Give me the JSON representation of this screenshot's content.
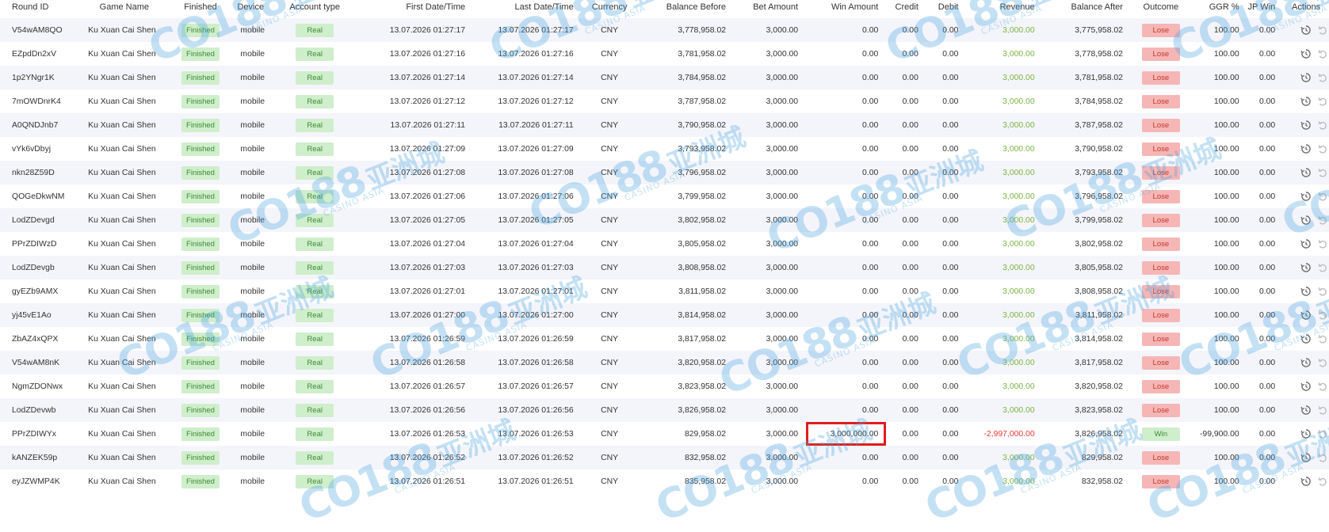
{
  "columns": [
    "Round ID",
    "Game Name",
    "Finished",
    "Device",
    "Account type",
    "First Date/Time",
    "Last Date/Time",
    "Currency",
    "Balance Before",
    "Bet Amount",
    "Win Amount",
    "Credit",
    "Debit",
    "Revenue",
    "Balance After",
    "Outcome",
    "GGR %",
    "JP Win",
    "Actions"
  ],
  "watermark": {
    "logo": "CO188",
    "cn": "亚洲城",
    "sub": "CASINO ASIA"
  },
  "colors": {
    "accent_red": "#e11d1d",
    "positive": "#7cb342",
    "negative": "#e53935",
    "pill_green": "#cfeecb",
    "pill_red": "#f6b6b6"
  },
  "icons": {
    "history": "history-icon",
    "undo": "undo-icon"
  },
  "rows": [
    {
      "round_id": "V54wAM8QO",
      "game": "Ku Xuan Cai Shen",
      "finished": "Finished",
      "device": "mobile",
      "account": "Real",
      "first": "13.07.2026 01:27:17",
      "last": "13.07.2026 01:27:17",
      "currency": "CNY",
      "bal_before": "3,778,958.02",
      "bet": "3,000.00",
      "win": "0.00",
      "credit": "0.00",
      "debit": "0.00",
      "revenue": "3,000.00",
      "bal_after": "3,775,958.02",
      "outcome": "Lose",
      "ggr": "100.00",
      "jp": "0.00"
    },
    {
      "round_id": "EZpdDn2xV",
      "game": "Ku Xuan Cai Shen",
      "finished": "Finished",
      "device": "mobile",
      "account": "Real",
      "first": "13.07.2026 01:27:16",
      "last": "13.07.2026 01:27:16",
      "currency": "CNY",
      "bal_before": "3,781,958.02",
      "bet": "3,000.00",
      "win": "0.00",
      "credit": "0.00",
      "debit": "0.00",
      "revenue": "3,000.00",
      "bal_after": "3,778,958.02",
      "outcome": "Lose",
      "ggr": "100.00",
      "jp": "0.00"
    },
    {
      "round_id": "1p2YNgr1K",
      "game": "Ku Xuan Cai Shen",
      "finished": "Finished",
      "device": "mobile",
      "account": "Real",
      "first": "13.07.2026 01:27:14",
      "last": "13.07.2026 01:27:14",
      "currency": "CNY",
      "bal_before": "3,784,958.02",
      "bet": "3,000.00",
      "win": "0.00",
      "credit": "0.00",
      "debit": "0.00",
      "revenue": "3,000.00",
      "bal_after": "3,781,958.02",
      "outcome": "Lose",
      "ggr": "100.00",
      "jp": "0.00"
    },
    {
      "round_id": "7mOWDnrK4",
      "game": "Ku Xuan Cai Shen",
      "finished": "Finished",
      "device": "mobile",
      "account": "Real",
      "first": "13.07.2026 01:27:12",
      "last": "13.07.2026 01:27:12",
      "currency": "CNY",
      "bal_before": "3,787,958.02",
      "bet": "3,000.00",
      "win": "0.00",
      "credit": "0.00",
      "debit": "0.00",
      "revenue": "3,000.00",
      "bal_after": "3,784,958.02",
      "outcome": "Lose",
      "ggr": "100.00",
      "jp": "0.00"
    },
    {
      "round_id": "A0QNDJnb7",
      "game": "Ku Xuan Cai Shen",
      "finished": "Finished",
      "device": "mobile",
      "account": "Real",
      "first": "13.07.2026 01:27:11",
      "last": "13.07.2026 01:27:11",
      "currency": "CNY",
      "bal_before": "3,790,958.02",
      "bet": "3,000.00",
      "win": "0.00",
      "credit": "0.00",
      "debit": "0.00",
      "revenue": "3,000.00",
      "bal_after": "3,787,958.02",
      "outcome": "Lose",
      "ggr": "100.00",
      "jp": "0.00"
    },
    {
      "round_id": "vYk6vDbyj",
      "game": "Ku Xuan Cai Shen",
      "finished": "Finished",
      "device": "mobile",
      "account": "Real",
      "first": "13.07.2026 01:27:09",
      "last": "13.07.2026 01:27:09",
      "currency": "CNY",
      "bal_before": "3,793,958.02",
      "bet": "3,000.00",
      "win": "0.00",
      "credit": "0.00",
      "debit": "0.00",
      "revenue": "3,000.00",
      "bal_after": "3,790,958.02",
      "outcome": "Lose",
      "ggr": "100.00",
      "jp": "0.00"
    },
    {
      "round_id": "nkn28Z59D",
      "game": "Ku Xuan Cai Shen",
      "finished": "Finished",
      "device": "mobile",
      "account": "Real",
      "first": "13.07.2026 01:27:08",
      "last": "13.07.2026 01:27:08",
      "currency": "CNY",
      "bal_before": "3,796,958.02",
      "bet": "3,000.00",
      "win": "0.00",
      "credit": "0.00",
      "debit": "0.00",
      "revenue": "3,000.00",
      "bal_after": "3,793,958.02",
      "outcome": "Lose",
      "ggr": "100.00",
      "jp": "0.00"
    },
    {
      "round_id": "QOGeDkwNM",
      "game": "Ku Xuan Cai Shen",
      "finished": "Finished",
      "device": "mobile",
      "account": "Real",
      "first": "13.07.2026 01:27:06",
      "last": "13.07.2026 01:27:06",
      "currency": "CNY",
      "bal_before": "3,799,958.02",
      "bet": "3,000.00",
      "win": "0.00",
      "credit": "0.00",
      "debit": "0.00",
      "revenue": "3,000.00",
      "bal_after": "3,796,958.02",
      "outcome": "Lose",
      "ggr": "100.00",
      "jp": "0.00"
    },
    {
      "round_id": "LodZDevgd",
      "game": "Ku Xuan Cai Shen",
      "finished": "Finished",
      "device": "mobile",
      "account": "Real",
      "first": "13.07.2026 01:27:05",
      "last": "13.07.2026 01:27:05",
      "currency": "CNY",
      "bal_before": "3,802,958.02",
      "bet": "3,000.00",
      "win": "0.00",
      "credit": "0.00",
      "debit": "0.00",
      "revenue": "3,000.00",
      "bal_after": "3,799,958.02",
      "outcome": "Lose",
      "ggr": "100.00",
      "jp": "0.00"
    },
    {
      "round_id": "PPrZDIWzD",
      "game": "Ku Xuan Cai Shen",
      "finished": "Finished",
      "device": "mobile",
      "account": "Real",
      "first": "13.07.2026 01:27:04",
      "last": "13.07.2026 01:27:04",
      "currency": "CNY",
      "bal_before": "3,805,958.02",
      "bet": "3,000.00",
      "win": "0.00",
      "credit": "0.00",
      "debit": "0.00",
      "revenue": "3,000.00",
      "bal_after": "3,802,958.02",
      "outcome": "Lose",
      "ggr": "100.00",
      "jp": "0.00"
    },
    {
      "round_id": "LodZDevgb",
      "game": "Ku Xuan Cai Shen",
      "finished": "Finished",
      "device": "mobile",
      "account": "Real",
      "first": "13.07.2026 01:27:03",
      "last": "13.07.2026 01:27:03",
      "currency": "CNY",
      "bal_before": "3,808,958.02",
      "bet": "3,000.00",
      "win": "0.00",
      "credit": "0.00",
      "debit": "0.00",
      "revenue": "3,000.00",
      "bal_after": "3,805,958.02",
      "outcome": "Lose",
      "ggr": "100.00",
      "jp": "0.00"
    },
    {
      "round_id": "gyEZb9AMX",
      "game": "Ku Xuan Cai Shen",
      "finished": "Finished",
      "device": "mobile",
      "account": "Real",
      "first": "13.07.2026 01:27:01",
      "last": "13.07.2026 01:27:01",
      "currency": "CNY",
      "bal_before": "3,811,958.02",
      "bet": "3,000.00",
      "win": "0.00",
      "credit": "0.00",
      "debit": "0.00",
      "revenue": "3,000.00",
      "bal_after": "3,808,958.02",
      "outcome": "Lose",
      "ggr": "100.00",
      "jp": "0.00"
    },
    {
      "round_id": "yj45vE1Ao",
      "game": "Ku Xuan Cai Shen",
      "finished": "Finished",
      "device": "mobile",
      "account": "Real",
      "first": "13.07.2026 01:27:00",
      "last": "13.07.2026 01:27:00",
      "currency": "CNY",
      "bal_before": "3,814,958.02",
      "bet": "3,000.00",
      "win": "0.00",
      "credit": "0.00",
      "debit": "0.00",
      "revenue": "3,000.00",
      "bal_after": "3,811,958.02",
      "outcome": "Lose",
      "ggr": "100.00",
      "jp": "0.00"
    },
    {
      "round_id": "ZbAZ4xQPX",
      "game": "Ku Xuan Cai Shen",
      "finished": "Finished",
      "device": "mobile",
      "account": "Real",
      "first": "13.07.2026 01:26:59",
      "last": "13.07.2026 01:26:59",
      "currency": "CNY",
      "bal_before": "3,817,958.02",
      "bet": "3,000.00",
      "win": "0.00",
      "credit": "0.00",
      "debit": "0.00",
      "revenue": "3,000.00",
      "bal_after": "3,814,958.02",
      "outcome": "Lose",
      "ggr": "100.00",
      "jp": "0.00"
    },
    {
      "round_id": "V54wAM8nK",
      "game": "Ku Xuan Cai Shen",
      "finished": "Finished",
      "device": "mobile",
      "account": "Real",
      "first": "13.07.2026 01:26:58",
      "last": "13.07.2026 01:26:58",
      "currency": "CNY",
      "bal_before": "3,820,958.02",
      "bet": "3,000.00",
      "win": "0.00",
      "credit": "0.00",
      "debit": "0.00",
      "revenue": "3,000.00",
      "bal_after": "3,817,958.02",
      "outcome": "Lose",
      "ggr": "100.00",
      "jp": "0.00"
    },
    {
      "round_id": "NgmZDONwx",
      "game": "Ku Xuan Cai Shen",
      "finished": "Finished",
      "device": "mobile",
      "account": "Real",
      "first": "13.07.2026 01:26:57",
      "last": "13.07.2026 01:26:57",
      "currency": "CNY",
      "bal_before": "3,823,958.02",
      "bet": "3,000.00",
      "win": "0.00",
      "credit": "0.00",
      "debit": "0.00",
      "revenue": "3,000.00",
      "bal_after": "3,820,958.02",
      "outcome": "Lose",
      "ggr": "100.00",
      "jp": "0.00"
    },
    {
      "round_id": "LodZDevwb",
      "game": "Ku Xuan Cai Shen",
      "finished": "Finished",
      "device": "mobile",
      "account": "Real",
      "first": "13.07.2026 01:26:56",
      "last": "13.07.2026 01:26:56",
      "currency": "CNY",
      "bal_before": "3,826,958.02",
      "bet": "3,000.00",
      "win": "0.00",
      "credit": "0.00",
      "debit": "0.00",
      "revenue": "3,000.00",
      "bal_after": "3,823,958.02",
      "outcome": "Lose",
      "ggr": "100.00",
      "jp": "0.00"
    },
    {
      "round_id": "PPrZDIWYx",
      "game": "Ku Xuan Cai Shen",
      "finished": "Finished",
      "device": "mobile",
      "account": "Real",
      "first": "13.07.2026 01:26:53",
      "last": "13.07.2026 01:26:53",
      "currency": "CNY",
      "bal_before": "829,958.02",
      "bet": "3,000.00",
      "win": "3,000,000.00",
      "credit": "0.00",
      "debit": "0.00",
      "revenue": "-2,997,000.00",
      "bal_after": "3,826,958.02",
      "outcome": "Win",
      "ggr": "-99,900.00",
      "jp": "0.00",
      "highlight_win": true
    },
    {
      "round_id": "kANZEK59p",
      "game": "Ku Xuan Cai Shen",
      "finished": "Finished",
      "device": "mobile",
      "account": "Real",
      "first": "13.07.2026 01:26:52",
      "last": "13.07.2026 01:26:52",
      "currency": "CNY",
      "bal_before": "832,958.02",
      "bet": "3,000.00",
      "win": "0.00",
      "credit": "0.00",
      "debit": "0.00",
      "revenue": "3,000.00",
      "bal_after": "829,958.02",
      "outcome": "Lose",
      "ggr": "100.00",
      "jp": "0.00"
    },
    {
      "round_id": "eyJZWMP4K",
      "game": "Ku Xuan Cai Shen",
      "finished": "Finished",
      "device": "mobile",
      "account": "Real",
      "first": "13.07.2026 01:26:51",
      "last": "13.07.2026 01:26:51",
      "currency": "CNY",
      "bal_before": "835,958.02",
      "bet": "3,000.00",
      "win": "0.00",
      "credit": "0.00",
      "debit": "0.00",
      "revenue": "3,000.00",
      "bal_after": "832,958.02",
      "outcome": "Lose",
      "ggr": "100.00",
      "jp": "0.00"
    }
  ]
}
